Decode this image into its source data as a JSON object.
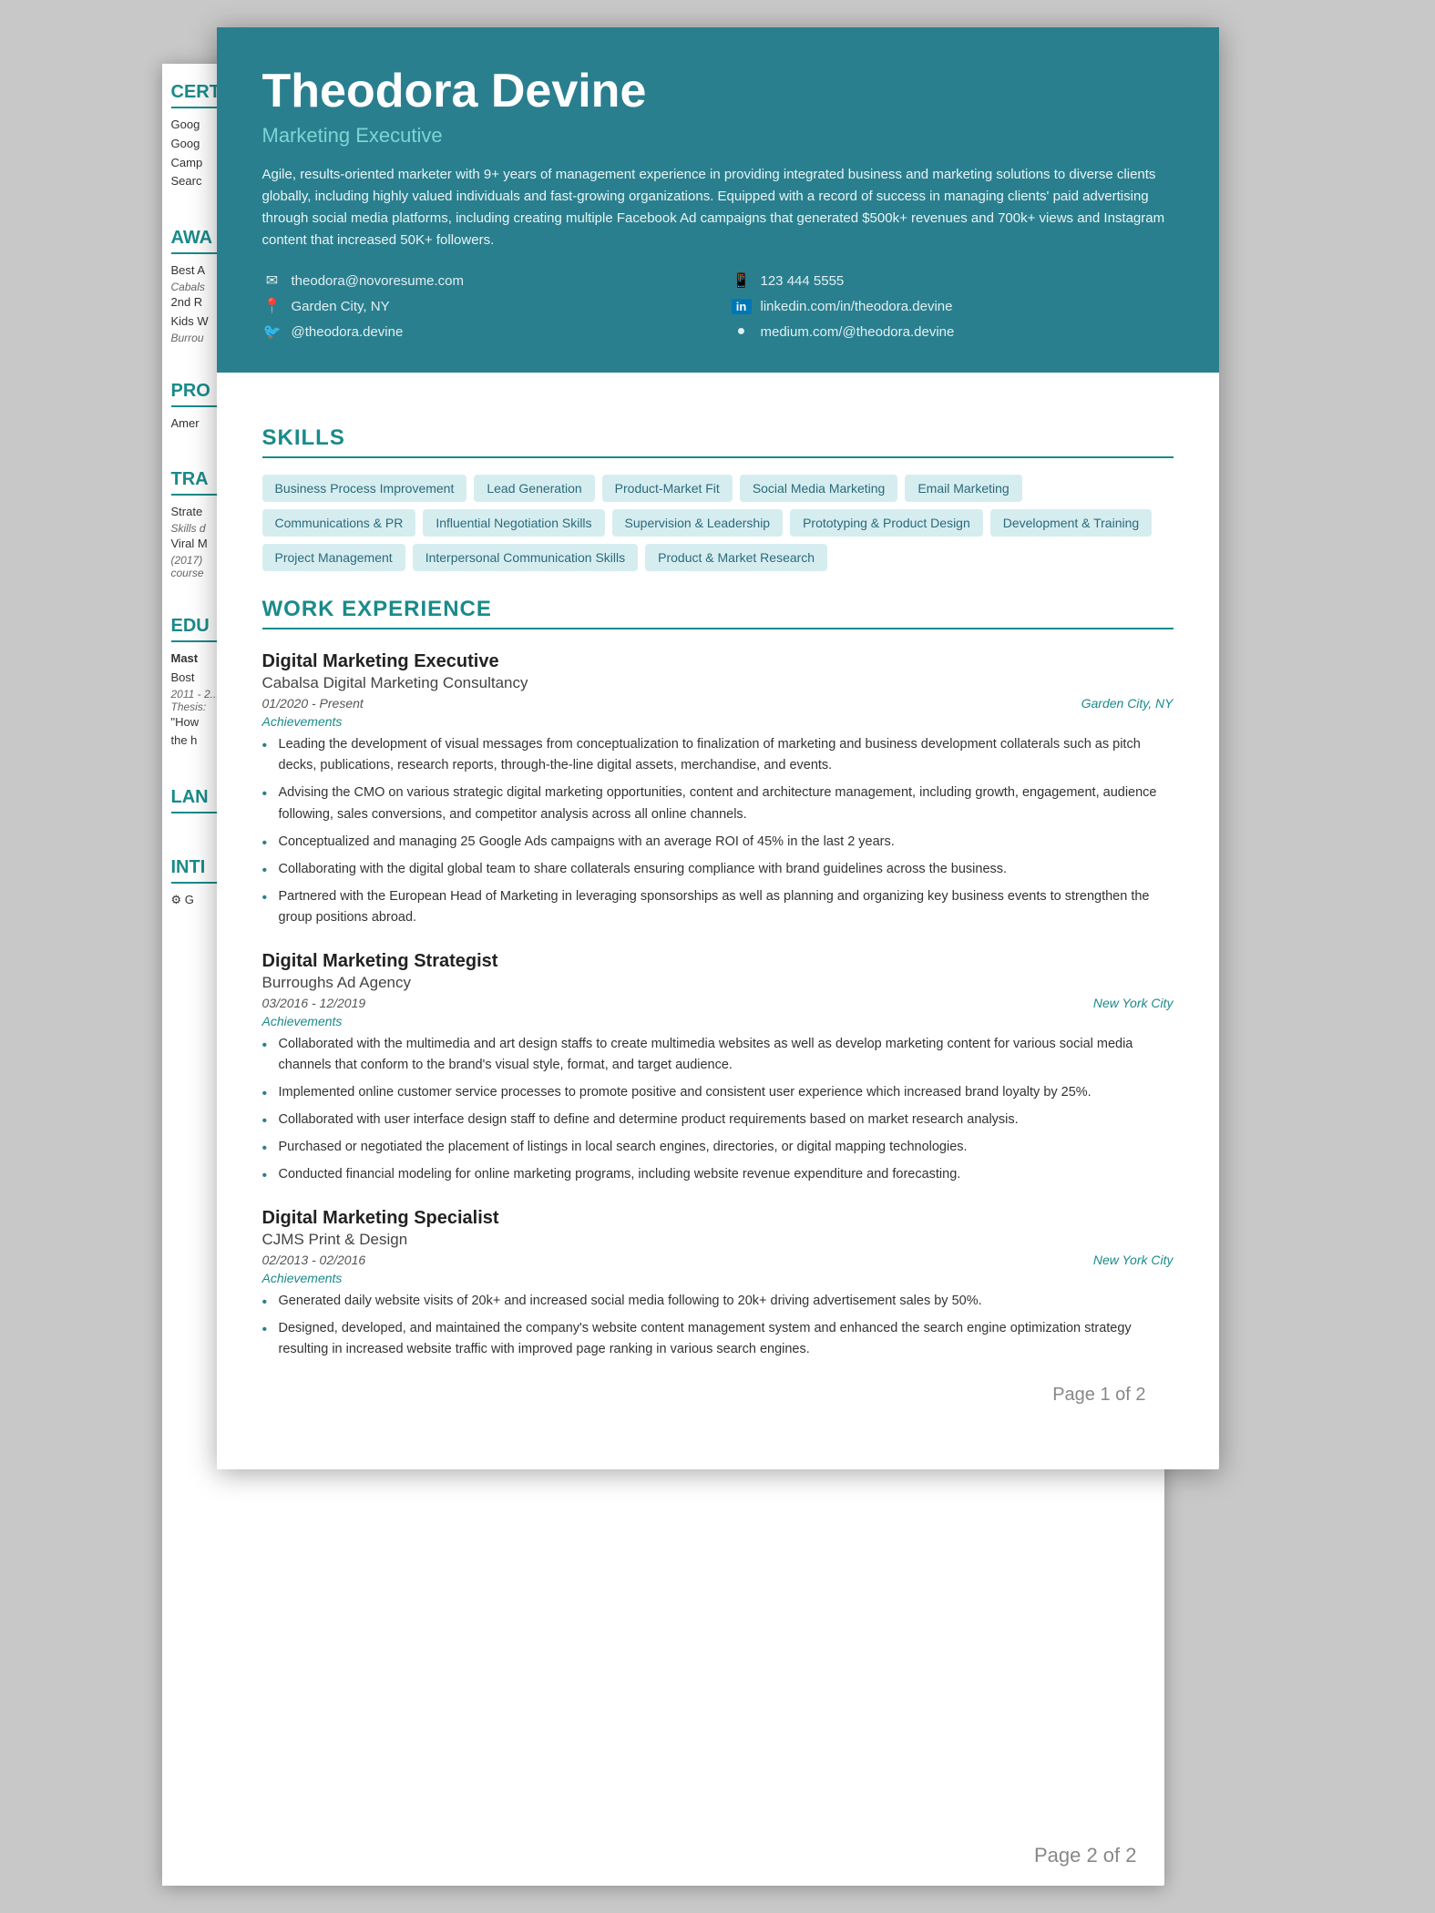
{
  "meta": {
    "page1_label": "Page 1 of 2",
    "page2_label": "Page 2 of 2"
  },
  "header": {
    "name": "Theodora Devine",
    "title": "Marketing Executive",
    "summary": "Agile, results-oriented marketer with 9+ years of management experience in providing integrated business and marketing solutions to diverse clients globally, including highly valued individuals and fast-growing organizations. Equipped with a record of success in managing clients' paid advertising through social media platforms, including creating multiple Facebook Ad campaigns that generated $500k+ revenues and 700k+ views and Instagram content that increased 50K+ followers.",
    "contact": [
      {
        "icon": "✉",
        "text": "theodora@novoresume.com"
      },
      {
        "icon": "📱",
        "text": "123 444 5555"
      },
      {
        "icon": "📍",
        "text": "Garden City, NY"
      },
      {
        "icon": "in",
        "text": "linkedin.com/in/theodora.devine"
      },
      {
        "icon": "🐦",
        "text": "@theodora.devine"
      },
      {
        "icon": "●",
        "text": "medium.com/@theodora.devine"
      }
    ]
  },
  "skills": {
    "section_title": "SKILLS",
    "tags": [
      "Business Process Improvement",
      "Lead Generation",
      "Product-Market Fit",
      "Social Media Marketing",
      "Email Marketing",
      "Communications & PR",
      "Influential Negotiation Skills",
      "Supervision & Leadership",
      "Prototyping & Product Design",
      "Development & Training",
      "Project Management",
      "Interpersonal Communication Skills",
      "Product & Market Research"
    ]
  },
  "work_experience": {
    "section_title": "WORK EXPERIENCE",
    "jobs": [
      {
        "title": "Digital Marketing Executive",
        "company": "Cabalsa Digital Marketing Consultancy",
        "dates": "01/2020 - Present",
        "location": "Garden City, NY",
        "achievements_label": "Achievements",
        "bullets": [
          "Leading the development of visual messages from conceptualization to finalization of marketing and business development collaterals such as pitch decks, publications, research reports, through-the-line digital assets, merchandise, and events.",
          "Advising the CMO on various strategic digital marketing opportunities, content and architecture management, including growth, engagement, audience following, sales conversions, and competitor analysis across all online channels.",
          "Conceptualized and managing 25 Google Ads campaigns with an average ROI of 45% in the last 2 years.",
          "Collaborating with the digital global team to share collaterals ensuring compliance with brand guidelines across the business.",
          "Partnered with the European Head of Marketing in leveraging sponsorships as well as planning and organizing key business events to strengthen the group positions abroad."
        ]
      },
      {
        "title": "Digital Marketing Strategist",
        "company": "Burroughs Ad Agency",
        "dates": "03/2016 - 12/2019",
        "location": "New York City",
        "achievements_label": "Achievements",
        "bullets": [
          "Collaborated with the multimedia and art design staffs to create multimedia websites as well as develop marketing content for various social media channels that conform to the brand's visual style, format, and target audience.",
          "Implemented online customer service processes to promote positive and consistent user experience which increased brand loyalty by 25%.",
          "Collaborated with user interface design staff to define and determine product requirements based on market research analysis.",
          "Purchased or negotiated the placement of listings in local search engines, directories, or digital mapping technologies.",
          "Conducted financial modeling for online marketing programs, including website revenue expenditure and forecasting."
        ]
      },
      {
        "title": "Digital Marketing Specialist",
        "company": "CJMS Print & Design",
        "dates": "02/2013 - 02/2016",
        "location": "New York City",
        "achievements_label": "Achievements",
        "bullets": [
          "Generated daily website visits of 20k+ and increased social media following to 20k+ driving advertisement sales by 50%.",
          "Designed, developed, and maintained the company's website content management system and enhanced the search engine optimization strategy resulting in increased website traffic with improved page ranking in various search engines."
        ]
      }
    ]
  },
  "sidebar": {
    "certifications_title": "CERT",
    "cert_items": [
      {
        "main": "Goog",
        "sub": ""
      },
      {
        "main": "Goog",
        "sub": ""
      },
      {
        "main": "Camp",
        "sub": ""
      },
      {
        "main": "Searc",
        "sub": ""
      }
    ],
    "awards_title": "AWA",
    "award_items": [
      {
        "main": "Best A",
        "sub": "Cabals"
      },
      {
        "main": "2nd R",
        "sub": "Kids W"
      },
      {
        "main": "",
        "sub": "Burrou"
      }
    ],
    "projects_title": "PRO",
    "project_items": [
      {
        "main": "Amer",
        "sub": ""
      }
    ],
    "training_title": "TRA",
    "training_items": [
      {
        "main": "Strate",
        "sub": "Skills d"
      },
      {
        "main": "Viral M",
        "sub": "(2017)"
      },
      {
        "main": "",
        "sub": "course"
      }
    ],
    "education_title": "EDU",
    "education_items": [
      {
        "main": "Mast",
        "sub": "Bost"
      },
      {
        "main": "2011 - 2",
        "sub": "Thesis"
      },
      {
        "main": "\"How",
        "sub": "the h"
      }
    ],
    "languages_title": "LAN",
    "interests_title": "INTI",
    "interests_items": [
      {
        "main": "⚙ G",
        "sub": ""
      }
    ]
  }
}
